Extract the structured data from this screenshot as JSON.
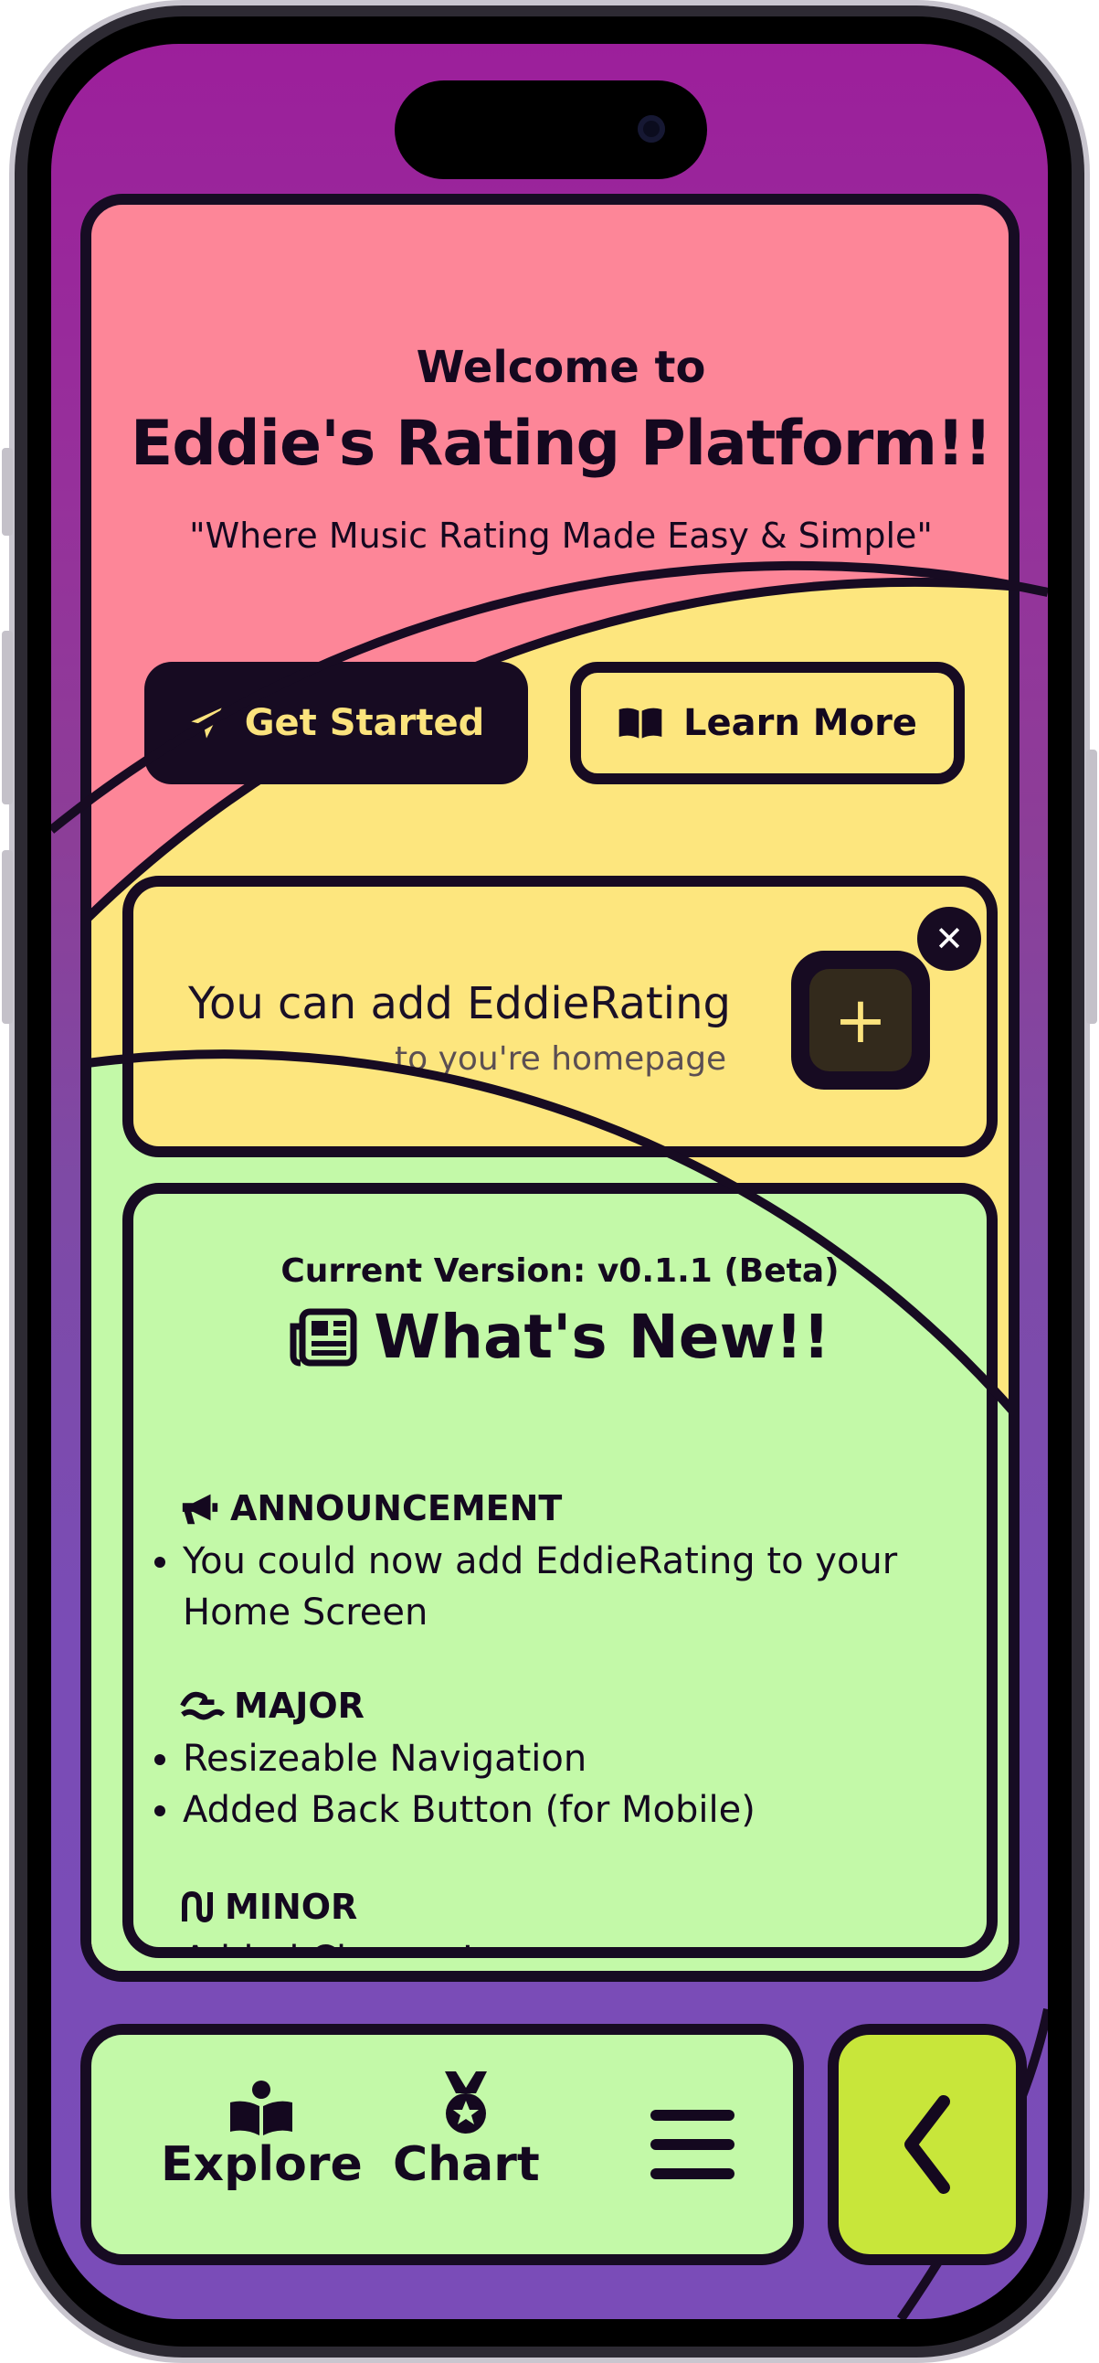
{
  "hero": {
    "welcome": "Welcome to",
    "platform_name": "Eddie's Rating Platform!!",
    "tagline": "\"Where Music Rating Made Easy & Simple\"",
    "get_started_label": "Get Started",
    "learn_more_label": "Learn More"
  },
  "install_prompt": {
    "line1": "You can add EddieRating",
    "line2": "to you're homepage",
    "add_icon": "plus-icon",
    "close_icon": "close-icon"
  },
  "whats_new": {
    "version": "Current Version: v0.1.1 (Beta)",
    "title": "What's New!!",
    "sections": [
      {
        "title": "ANNOUNCEMENT",
        "icon": "megaphone-icon",
        "items": [
          "You could now add EddieRating to your Home Screen"
        ]
      },
      {
        "title": "MAJOR",
        "icon": "wave-icon",
        "items": [
          "Resizeable Navigation",
          "Added Back Button (for Mobile)"
        ]
      },
      {
        "title": "MINOR",
        "icon": "squiggle-icon",
        "items": [
          "Added Change Log"
        ]
      }
    ]
  },
  "nav": {
    "explore_label": "Explore",
    "chart_label": "Chart",
    "menu_icon": "hamburger-icon",
    "back_icon": "chevron-left-icon"
  },
  "colors": {
    "hero_bg": "#fd8698",
    "yellow": "#fde67e",
    "green": "#c3f9a8",
    "dark": "#170b22",
    "lime": "#c8e63a"
  }
}
